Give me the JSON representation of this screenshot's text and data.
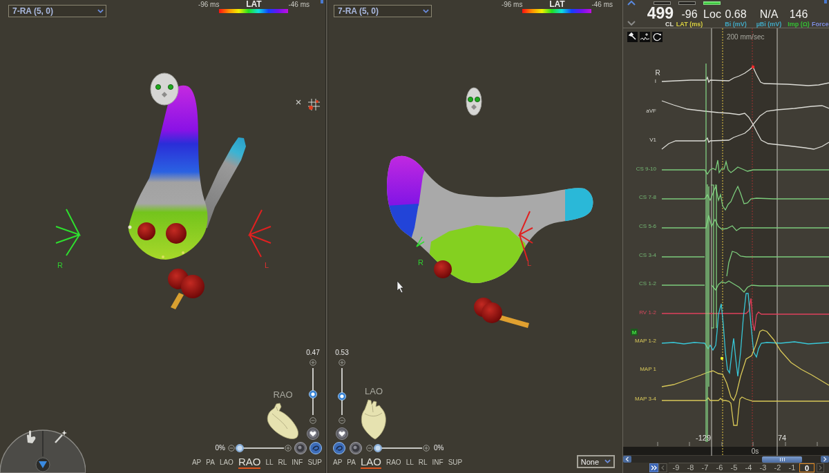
{
  "panes": [
    {
      "map_select": "7-RA (5, 0)",
      "scale": {
        "min": "-96 ms",
        "title": "LAT",
        "max": "-46 ms"
      },
      "axis_labels": {
        "right": "R",
        "left": "L"
      },
      "zoom": {
        "reading": "0.47",
        "level": 0.43
      },
      "view_label": "RAO",
      "transparency": {
        "reading": "0%",
        "level": 0
      },
      "views": [
        {
          "label": "AP",
          "selected": false
        },
        {
          "label": "PA",
          "selected": false
        },
        {
          "label": "LAO",
          "selected": false
        },
        {
          "label": "RAO",
          "selected": true
        },
        {
          "label": "LL",
          "selected": false
        },
        {
          "label": "RL",
          "selected": false
        },
        {
          "label": "INF",
          "selected": false
        },
        {
          "label": "SUP",
          "selected": false
        }
      ]
    },
    {
      "map_select": "7-RA (5, 0)",
      "scale": {
        "min": "-96 ms",
        "title": "LAT",
        "max": "-46 ms"
      },
      "axis_labels": {
        "right": "R",
        "left": "L"
      },
      "zoom": {
        "reading": "0.53",
        "level": 0.38
      },
      "view_label": "LAO",
      "transparency": {
        "reading": "0%",
        "level": 0
      },
      "views": [
        {
          "label": "AP",
          "selected": false
        },
        {
          "label": "PA",
          "selected": false
        },
        {
          "label": "LAO",
          "selected": true
        },
        {
          "label": "RAO",
          "selected": false
        },
        {
          "label": "LL",
          "selected": false
        },
        {
          "label": "RL",
          "selected": false
        },
        {
          "label": "INF",
          "selected": false
        },
        {
          "label": "SUP",
          "selected": false
        }
      ],
      "overlay_select": "None"
    }
  ],
  "signals": {
    "indicators": [
      {
        "on": false
      },
      {
        "on": false
      },
      {
        "on": true
      }
    ],
    "readouts": [
      {
        "kind": "main",
        "value": "499",
        "label": "CL",
        "color": "#e6e6e0"
      },
      {
        "kind": "value",
        "value": "-96",
        "label": "LAT (ms)",
        "color": "#d8d040"
      },
      {
        "kind": "value",
        "value": "Loc"
      },
      {
        "kind": "value",
        "value": "0.68",
        "label": "Bi (mV)",
        "color": "#40a8c4"
      },
      {
        "kind": "value",
        "value": "N/A",
        "label": "µBi (mV)",
        "color": "#40a8c4"
      },
      {
        "kind": "value",
        "value": "146",
        "label": "Imp (Ω)",
        "color": "#34c034"
      },
      {
        "kind": "value",
        "label": "Force",
        "color": "#7c8ce0"
      }
    ],
    "speed": "200 mm/sec",
    "channels": [
      {
        "label": "I",
        "marker": "R",
        "kind": "surface",
        "color": "#dcdcd6"
      },
      {
        "label": "aVF",
        "kind": "surface",
        "color": "#dcdcd6"
      },
      {
        "label": "V1",
        "kind": "surface",
        "color": "#dcdcd6"
      },
      {
        "label": "CS 9-10",
        "kind": "cs",
        "color": "#7ccc7c"
      },
      {
        "label": "CS 7-8",
        "kind": "cs",
        "color": "#7ccc7c"
      },
      {
        "label": "CS 5-6",
        "kind": "cs",
        "color": "#7ccc7c"
      },
      {
        "label": "CS 3-4",
        "kind": "cs",
        "color": "#7ccc7c"
      },
      {
        "label": "CS 1-2",
        "kind": "cs",
        "color": "#7ccc7c"
      },
      {
        "label": "RV 1-2",
        "kind": "rv",
        "color": "#e0405c"
      },
      {
        "label": "MAP 1-2",
        "marker": "M",
        "kind": "map",
        "color": "#38c8d8"
      },
      {
        "label": "MAP 1",
        "kind": "map",
        "color": "#d8c858"
      },
      {
        "label": "MAP 3-4",
        "kind": "map",
        "color": "#d8c858"
      }
    ],
    "window_marks": {
      "start": "-129",
      "end": "74"
    },
    "time": "0s",
    "pages": [
      {
        "label": "-9",
        "selected": false
      },
      {
        "label": "-8",
        "selected": false
      },
      {
        "label": "-7",
        "selected": false
      },
      {
        "label": "-6",
        "selected": false
      },
      {
        "label": "-5",
        "selected": false
      },
      {
        "label": "-4",
        "selected": false
      },
      {
        "label": "-3",
        "selected": false
      },
      {
        "label": "-2",
        "selected": false
      },
      {
        "label": "-1",
        "selected": false
      },
      {
        "label": "0",
        "selected": true
      }
    ]
  }
}
